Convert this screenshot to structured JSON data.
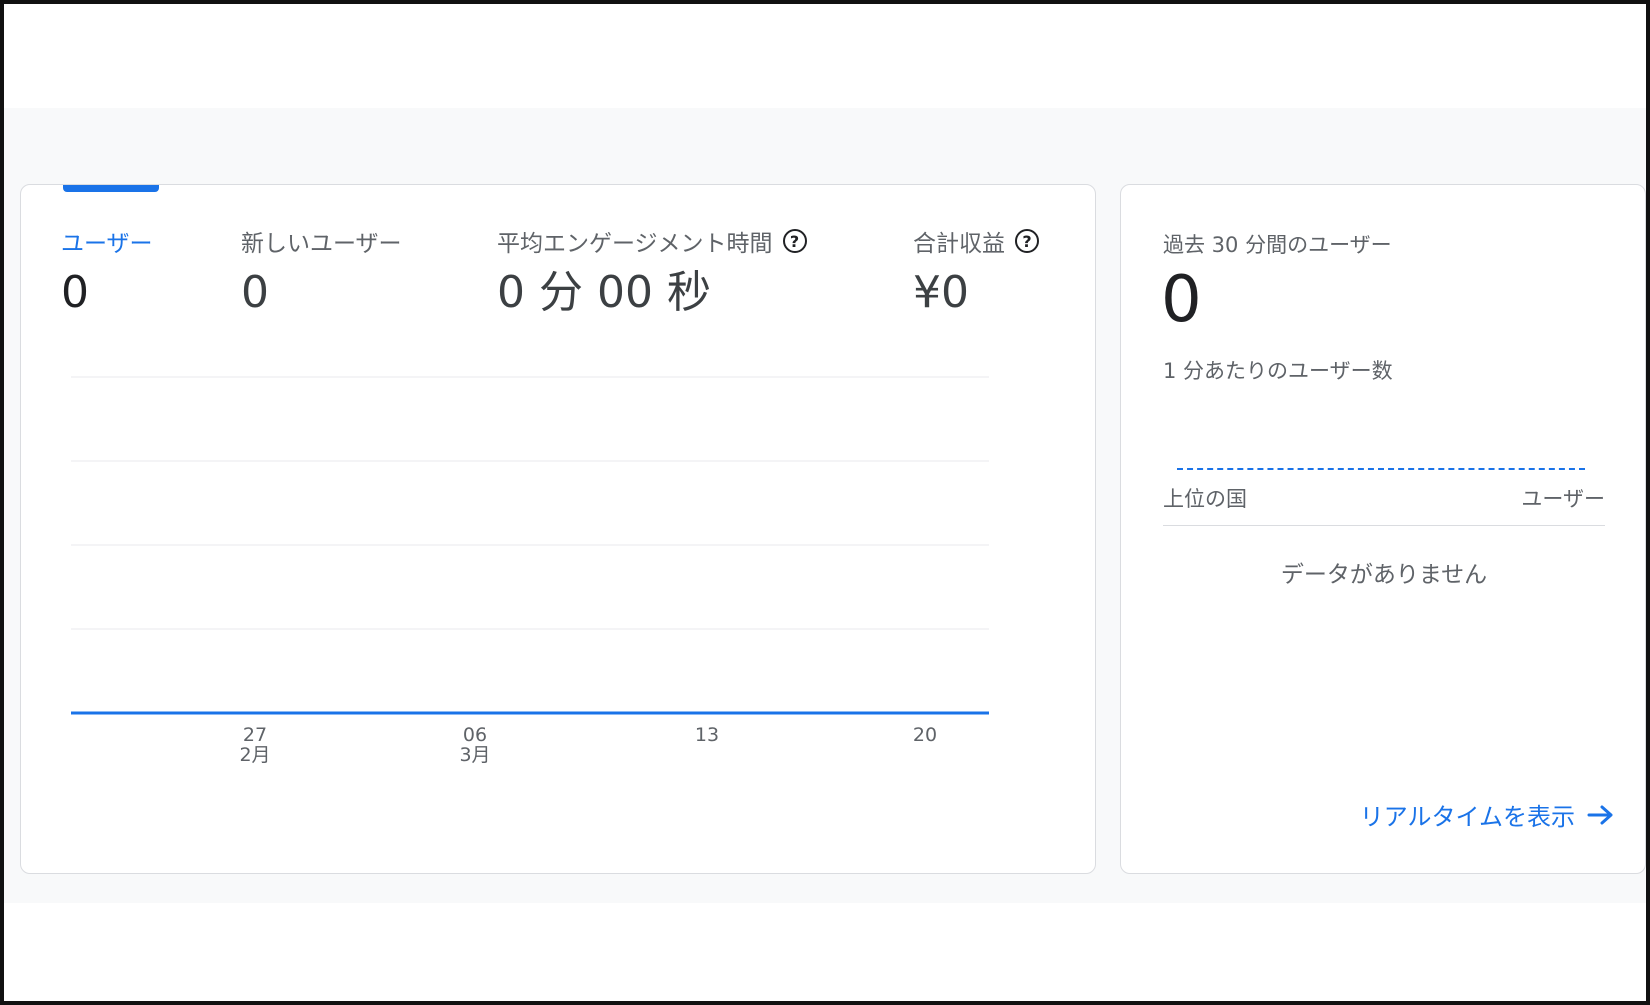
{
  "metrics": [
    {
      "label": "ユーザー",
      "value": "0",
      "active": true,
      "help": false
    },
    {
      "label": "新しいユーザー",
      "value": "0",
      "active": false,
      "help": false
    },
    {
      "label": "平均エンゲージメント時間",
      "value": "0 分 00 秒",
      "active": false,
      "help": true
    },
    {
      "label": "合計収益",
      "value": "¥0",
      "active": false,
      "help": true
    }
  ],
  "chart_data": {
    "type": "line",
    "x_ticks": [
      {
        "day": "27",
        "month": "2月"
      },
      {
        "day": "06",
        "month": "3月"
      },
      {
        "day": "13",
        "month": ""
      },
      {
        "day": "20",
        "month": ""
      }
    ],
    "series": [
      {
        "values": [
          0,
          0,
          0,
          0
        ]
      }
    ],
    "y_gridlines": 5,
    "grid": true,
    "color": "#1a73e8"
  },
  "realtime": {
    "title": "過去 30 分間のユーザー",
    "value": "0",
    "subtitle": "1 分あたりのユーザー数",
    "table_header_country": "上位の国",
    "table_header_users": "ユーザー",
    "empty_text": "データがありません",
    "link_label": "リアルタイムを表示"
  },
  "colors": {
    "accent": "#1a73e8",
    "text_secondary": "#5f6368",
    "background_band": "#f8f9fa"
  }
}
